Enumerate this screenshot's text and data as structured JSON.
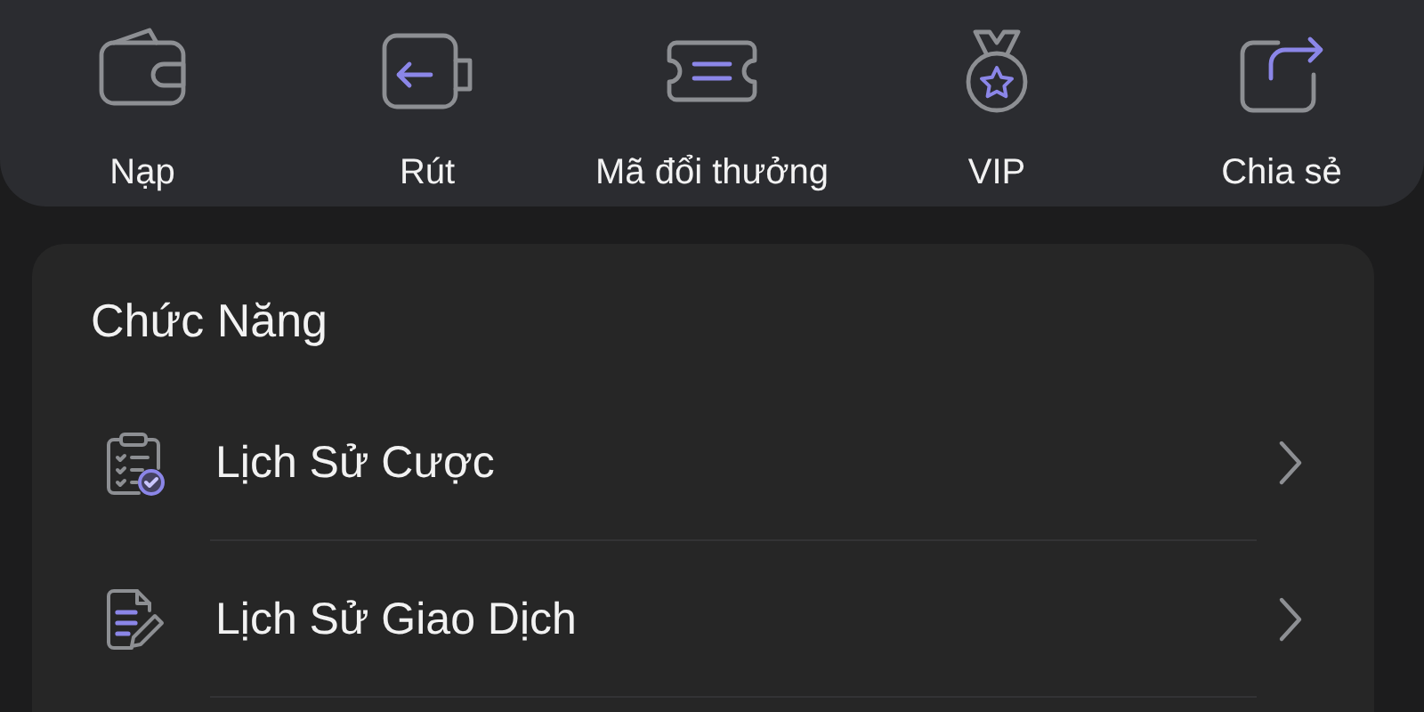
{
  "quick_actions": [
    {
      "label": "Nạp",
      "kind": "deposit"
    },
    {
      "label": "Rút",
      "kind": "withdraw"
    },
    {
      "label": "Mã đổi thưởng",
      "kind": "voucher"
    },
    {
      "label": "VIP",
      "kind": "vip"
    },
    {
      "label": "Chia sẻ",
      "kind": "share"
    }
  ],
  "functions": {
    "title": "Chức Năng",
    "items": [
      {
        "label": "Lịch Sử Cược",
        "kind": "bet-history"
      },
      {
        "label": "Lịch Sử Giao Dịch",
        "kind": "transaction-history"
      }
    ]
  }
}
